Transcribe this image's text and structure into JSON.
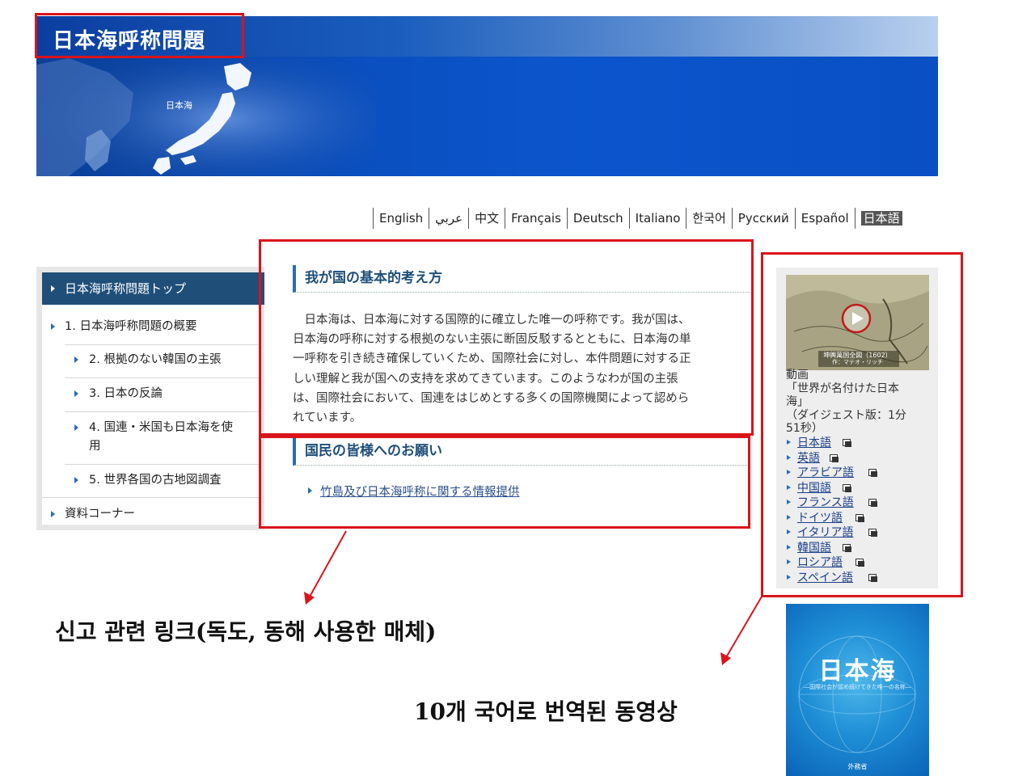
{
  "banner": {
    "title": "日本海呼称問題",
    "sea_label": "日本海"
  },
  "languages": [
    "English",
    "عربي",
    "中文",
    "Français",
    "Deutsch",
    "Italiano",
    "한국어",
    "Русский",
    "Español",
    "日本語"
  ],
  "nav": {
    "top": "日本海呼称問題トップ",
    "item1": "1. 日本海呼称問題の概要",
    "item2": "2. 根拠のない韓国の主張",
    "item3": "3. 日本の反論",
    "item4a": "4. 国連・米国も日本海を使",
    "item4b": "用",
    "item5": "5. 世界各国の古地図調査",
    "item6": "資料コーナー"
  },
  "main": {
    "section1_title": "我が国の基本的考え方",
    "section1_lines": [
      "日本海は、日本海に対する国際的に確立した唯一の呼称です。我が国は、",
      "日本海の呼称に対する根拠のない主張に断固反駁するとともに、日本海の単",
      "一呼称を引き続き確保していくため、国際社会に対し、本件問題に対する正",
      "しい理解と我が国への支持を求めてきています。このようなわが国の主張",
      "は、国際社会において、国連をはじめとする多くの国際機関によって認めら",
      "れています。"
    ],
    "section2_title": "国民の皆様へのお願い",
    "section2_link": "竹島及び日本海呼称に関する情報提供"
  },
  "sidebar": {
    "video_thumb_label": "坤輿萬国全図（1602）",
    "video_thumb_sub": "作：マテオ・リッチ",
    "caption_lines": [
      "動画",
      "「世界が名付けた日本",
      "海」",
      "（ダイジェスト版：1分",
      "51秒）"
    ],
    "video_links": [
      "日本語",
      "英語",
      "アラビア語",
      "中国語",
      "フランス語",
      "ドイツ語",
      "イタリア語",
      "韓国語",
      "ロシア語",
      "スペイン語"
    ]
  },
  "book": {
    "title": "日本海",
    "subtitle": "―国際社会が認め続けてきた唯一の名称―",
    "publisher": "外務省"
  },
  "annotations": {
    "left": "신고 관련 링크(독도, 동해 사용한 매체)",
    "right": "10개 국어로 번역된 동영상"
  },
  "colors": {
    "annotation_red": "#d9141b",
    "nav_active": "#1f4f79",
    "heading_blue": "#1f4f79",
    "link_blue": "#1a3f8a"
  }
}
